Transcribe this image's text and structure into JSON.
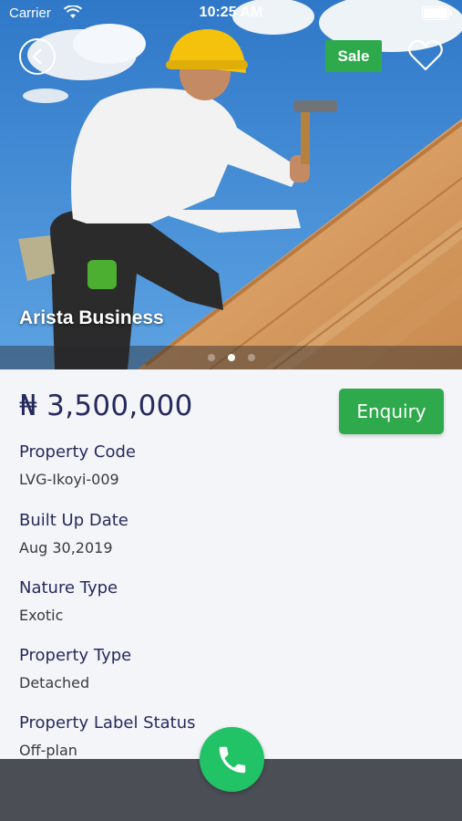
{
  "status_bar": {
    "carrier": "Carrier",
    "time": "10:25 AM",
    "wifi_icon": "wifi-icon",
    "battery_icon": "battery-icon"
  },
  "hero": {
    "title": "Arista Business",
    "badge": "Sale",
    "back_icon": "chevron-left-icon",
    "favorite_icon": "heart-outline-icon",
    "carousel": {
      "page_count": 3,
      "active_index": 1
    }
  },
  "property": {
    "currency_symbol": "₦",
    "price": "₦ 3,500,000",
    "enquiry_label": "Enquiry",
    "fields": [
      {
        "label": "Property Code",
        "value": "LVG-Ikoyi-009"
      },
      {
        "label": "Built Up Date",
        "value": "Aug 30,2019"
      },
      {
        "label": "Nature Type",
        "value": "Exotic"
      },
      {
        "label": "Property Type",
        "value": "Detached"
      },
      {
        "label": "Property Label Status",
        "value": "Off-plan"
      }
    ]
  },
  "actions": {
    "call_icon": "phone-icon"
  },
  "colors": {
    "accent_green": "#2eaa4c",
    "call_green": "#22c266",
    "text_navy": "#262a5c",
    "bottom_bar": "#4b4e55",
    "page_bg": "#f4f5f9"
  }
}
